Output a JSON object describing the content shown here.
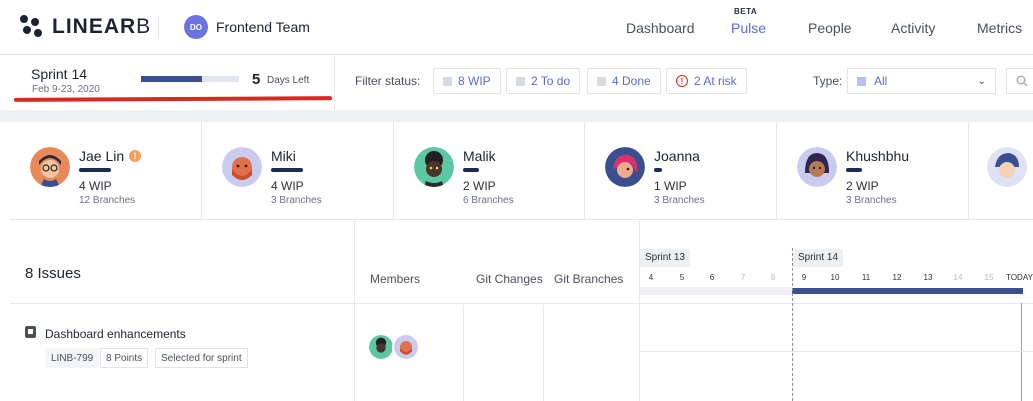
{
  "app": {
    "logo_main": "LINEAR",
    "logo_suffix": "B",
    "team_initials": "DO",
    "team_name": "Frontend Team"
  },
  "nav": {
    "items": [
      {
        "label": "Dashboard",
        "active": false
      },
      {
        "label": "Pulse",
        "active": true,
        "badge": "BETA"
      },
      {
        "label": "People",
        "active": false
      },
      {
        "label": "Activity",
        "active": false
      },
      {
        "label": "Metrics",
        "active": false
      }
    ]
  },
  "sprint": {
    "title": "Sprint 14",
    "dates": "Feb 9-23, 2020",
    "progress_fraction": 0.62,
    "days_left_number": "5",
    "days_left_label": "Days Left"
  },
  "filters": {
    "label": "Filter status:",
    "chips": [
      {
        "label": "8 WIP",
        "icon": "square"
      },
      {
        "label": "2 To do",
        "icon": "square"
      },
      {
        "label": "4 Done",
        "icon": "square"
      },
      {
        "label": "2 At risk",
        "icon": "alert"
      }
    ],
    "type_label": "Type:",
    "type_value": "All"
  },
  "members": [
    {
      "name": "Jae Lin",
      "wip": "4 WIP",
      "branches": "12 Branches",
      "warning": true,
      "avatar_color": "#e9895a",
      "bar_fraction": 1.0
    },
    {
      "name": "Miki",
      "wip": "4 WIP",
      "branches": "3 Branches",
      "warning": false,
      "avatar_color": "#c9ccef",
      "bar_fraction": 1.0
    },
    {
      "name": "Malik",
      "wip": "2 WIP",
      "branches": "6 Branches",
      "warning": false,
      "avatar_color": "#5bc8a3",
      "bar_fraction": 0.5
    },
    {
      "name": "Joanna",
      "wip": "1 WIP",
      "branches": "3 Branches",
      "warning": false,
      "avatar_color": "#3a4f8f",
      "bar_fraction": 0.25
    },
    {
      "name": "Khushbhu",
      "wip": "2 WIP",
      "branches": "3 Branches",
      "warning": false,
      "avatar_color": "#c9ccef",
      "bar_fraction": 0.5
    }
  ],
  "issues": {
    "count_label": "8 Issues",
    "columns": [
      "Members",
      "Git Changes",
      "Git Branches"
    ]
  },
  "timeline": {
    "prev_sprint": "Sprint 13",
    "current_sprint": "Sprint 14",
    "prev_days": [
      {
        "label": "4",
        "faded": false
      },
      {
        "label": "5",
        "faded": false
      },
      {
        "label": "6",
        "faded": false
      },
      {
        "label": "7",
        "faded": true
      },
      {
        "label": "8",
        "faded": true
      }
    ],
    "current_days": [
      {
        "label": "9",
        "faded": false
      },
      {
        "label": "10",
        "faded": false
      },
      {
        "label": "11",
        "faded": false
      },
      {
        "label": "12",
        "faded": false
      },
      {
        "label": "13",
        "faded": false
      },
      {
        "label": "14",
        "faded": true
      },
      {
        "label": "15",
        "faded": true
      }
    ],
    "today_label": "TODAY"
  },
  "issue_rows": [
    {
      "title": "Dashboard enhancements",
      "key": "LINB-799",
      "points": "8 Points",
      "status": "Selected for sprint"
    }
  ]
}
